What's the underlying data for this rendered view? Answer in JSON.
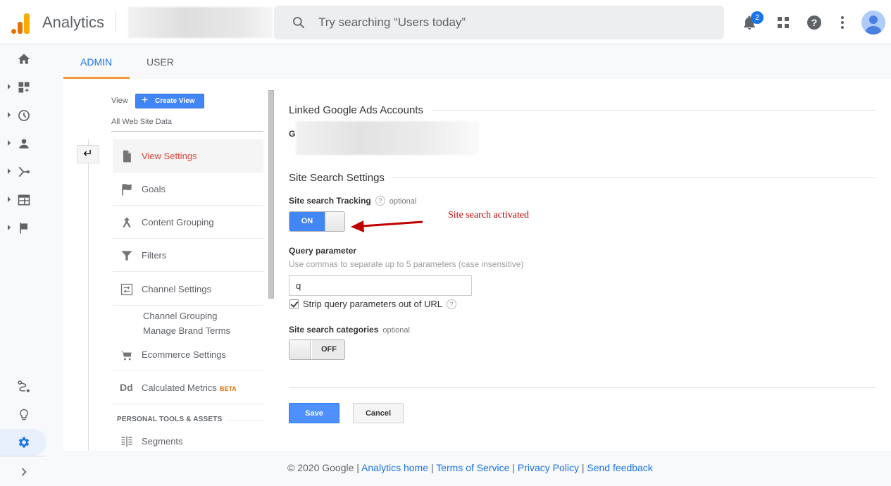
{
  "app": {
    "title": "Analytics",
    "search_placeholder": "Try searching “Users today”",
    "notifications_count": "2"
  },
  "leftnav": {
    "items": [
      {
        "name": "home",
        "icon": "home-icon"
      },
      {
        "name": "customization",
        "icon": "dashboard-add-icon"
      },
      {
        "name": "realtime",
        "icon": "clock-icon"
      },
      {
        "name": "audience",
        "icon": "person-icon"
      },
      {
        "name": "acquisition",
        "icon": "acquisition-icon"
      },
      {
        "name": "behavior",
        "icon": "behavior-icon"
      },
      {
        "name": "conversions",
        "icon": "flag-icon"
      }
    ],
    "bottom": [
      {
        "name": "attribution",
        "icon": "attribution-icon"
      },
      {
        "name": "discover",
        "icon": "lightbulb-icon"
      },
      {
        "name": "admin",
        "icon": "gear-icon",
        "active": true
      }
    ]
  },
  "tabs": [
    {
      "label": "ADMIN",
      "active": true
    },
    {
      "label": "USER",
      "active": false
    }
  ],
  "view_column": {
    "view_label": "View",
    "create_view_label": "Create View",
    "view_name": "All Web Site Data",
    "menu": [
      {
        "label": "View Settings",
        "icon": "document-icon",
        "active": true
      },
      {
        "label": "Goals",
        "icon": "flag-icon"
      },
      {
        "label": "Content Grouping",
        "icon": "content-grouping-icon"
      },
      {
        "label": "Filters",
        "icon": "filter-icon"
      },
      {
        "label": "Channel Settings",
        "icon": "channel-settings-icon"
      },
      {
        "label": "Ecommerce Settings",
        "icon": "cart-icon"
      },
      {
        "label": "Calculated Metrics",
        "icon": "calculated-metrics-icon",
        "badge": "BETA"
      }
    ],
    "channel_sub_items": [
      "Channel Grouping",
      "Manage Brand Terms"
    ],
    "section_header": "PERSONAL TOOLS & ASSETS",
    "personal_items": [
      {
        "label": "Segments",
        "icon": "segments-icon"
      }
    ]
  },
  "content": {
    "linked_ads_title": "Linked Google Ads Accounts",
    "linked_ads_partial": "G",
    "site_search_title": "Site Search Settings",
    "tracking_label": "Site search Tracking",
    "optional": "optional",
    "tracking_toggle": "ON",
    "tracking_enabled": true,
    "annotation": "Site search activated",
    "annotation_color": "#c00000",
    "query_param_label": "Query parameter",
    "query_param_hint": "Use commas to separate up to 5 parameters (case insensitive)",
    "query_param_value": "q",
    "strip_checkbox_label": "Strip query parameters out of URL",
    "strip_checked": true,
    "categories_label": "Site search categories",
    "categories_toggle": "OFF",
    "categories_enabled": false,
    "save_label": "Save",
    "cancel_label": "Cancel"
  },
  "footer": {
    "copyright": "© 2020 Google",
    "links": [
      "Analytics home",
      "Terms of Service",
      "Privacy Policy",
      "Send feedback"
    ],
    "separator": " | "
  },
  "colors": {
    "accent": "#1a73e8",
    "button_blue": "#4285f4",
    "active_menu": "#db4437",
    "tab_underline": "#f29b36",
    "beta": "#e8710a"
  }
}
